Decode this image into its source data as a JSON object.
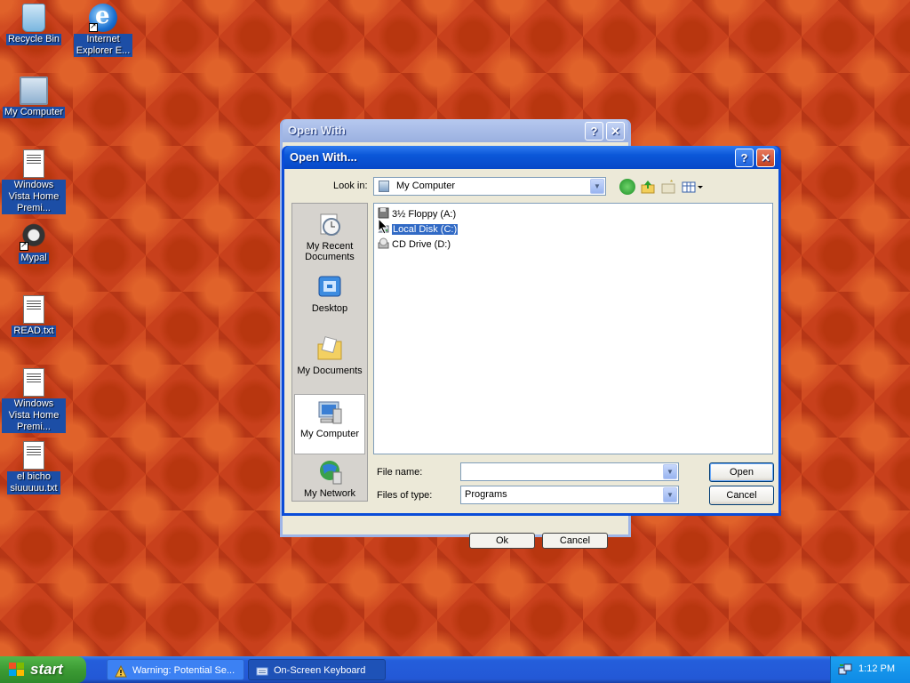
{
  "desktop": {
    "icons": [
      {
        "label": "Recycle Bin"
      },
      {
        "label": "Internet Explorer E..."
      },
      {
        "label": "My Computer"
      },
      {
        "label": "Windows Vista Home Premi..."
      },
      {
        "label": "Mypal"
      },
      {
        "label": "READ.txt"
      },
      {
        "label": "Windows Vista Home Premi..."
      },
      {
        "label": "el bicho siuuuuu.txt"
      }
    ]
  },
  "back_window": {
    "title": "Open With",
    "ok_label": "Ok",
    "cancel_label": "Cancel"
  },
  "dialog": {
    "title": "Open With...",
    "help_label": "?",
    "close_label": "✕",
    "look_in_label": "Look in:",
    "look_in_value": "My Computer",
    "places": [
      {
        "label": "My Recent Documents"
      },
      {
        "label": "Desktop"
      },
      {
        "label": "My Documents"
      },
      {
        "label": "My Computer"
      },
      {
        "label": "My Network"
      }
    ],
    "files": [
      {
        "name": "3½ Floppy (A:)",
        "selected": false
      },
      {
        "name": "Local Disk (C:)",
        "selected": true
      },
      {
        "name": "CD Drive (D:)",
        "selected": false
      }
    ],
    "file_name_label": "File name:",
    "file_name_value": "",
    "files_of_type_label": "Files of type:",
    "files_of_type_value": "Programs",
    "open_label": "Open",
    "cancel_label": "Cancel"
  },
  "taskbar": {
    "start_label": "start",
    "tasks": [
      {
        "label": "Warning: Potential Se...",
        "active": false
      },
      {
        "label": "On-Screen Keyboard",
        "active": true
      }
    ],
    "clock": "1:12 PM"
  },
  "colors": {
    "desktop_background": "#c8401c",
    "titlebar_active": "#0b57d8",
    "taskbar": "#245edb",
    "start_button": "#3c9b34",
    "selection": "#316ac5"
  }
}
